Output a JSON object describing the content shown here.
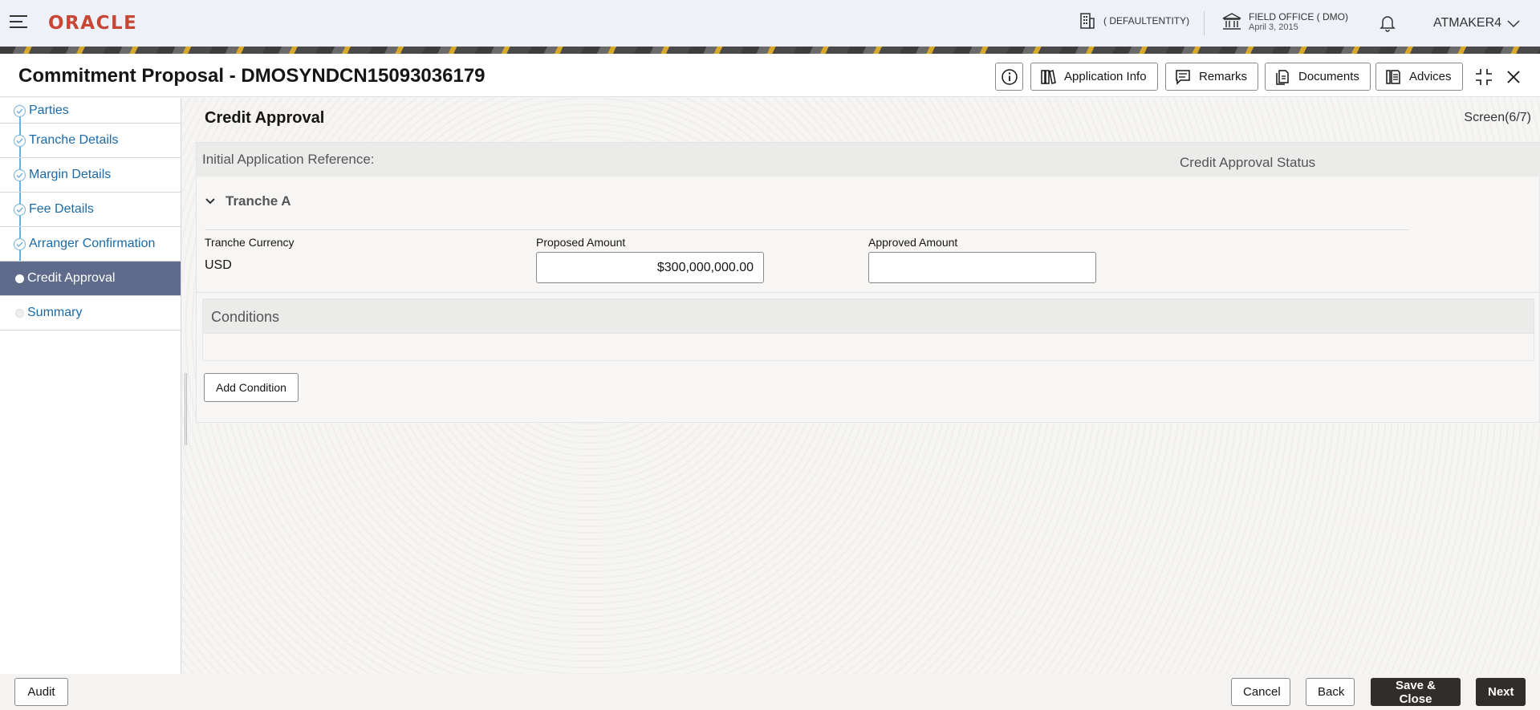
{
  "header": {
    "logo": "ORACLE",
    "entity": "( DEFAULTENTITY)",
    "office_name": "FIELD OFFICE ( DMO)",
    "office_date": "April 3, 2015",
    "user": "ATMAKER4"
  },
  "titlebar": {
    "title": "Commitment Proposal - DMOSYNDCN15093036179",
    "application_info": "Application Info",
    "remarks": "Remarks",
    "documents": "Documents",
    "advices": "Advices"
  },
  "sidebar": {
    "items": [
      {
        "label": "Parties",
        "state": "done"
      },
      {
        "label": "Tranche Details",
        "state": "done"
      },
      {
        "label": "Margin Details",
        "state": "done"
      },
      {
        "label": "Fee Details",
        "state": "done"
      },
      {
        "label": "Arranger Confirmation",
        "state": "done"
      },
      {
        "label": "Credit Approval",
        "state": "current"
      },
      {
        "label": "Summary",
        "state": "pending"
      }
    ]
  },
  "main": {
    "section_title": "Credit Approval",
    "screen": "Screen(6/7)",
    "initial_ref_label": "Initial Application Reference:",
    "status_label": "Credit Approval Status",
    "tranche_title": "Tranche A",
    "tranche_currency_label": "Tranche Currency",
    "tranche_currency_value": "USD",
    "proposed_amount_label": "Proposed Amount",
    "proposed_amount_value": "$300,000,000.00",
    "approved_amount_label": "Approved Amount",
    "approved_amount_value": "",
    "conditions_title": "Conditions",
    "add_condition": "Add Condition"
  },
  "footer": {
    "audit": "Audit",
    "cancel": "Cancel",
    "back": "Back",
    "save_close": "Save & Close",
    "next": "Next"
  },
  "colors": {
    "brand": "#c74634",
    "active_nav": "#5e6b8b",
    "link": "#1b6aa8",
    "primary_button": "#312d2a"
  }
}
